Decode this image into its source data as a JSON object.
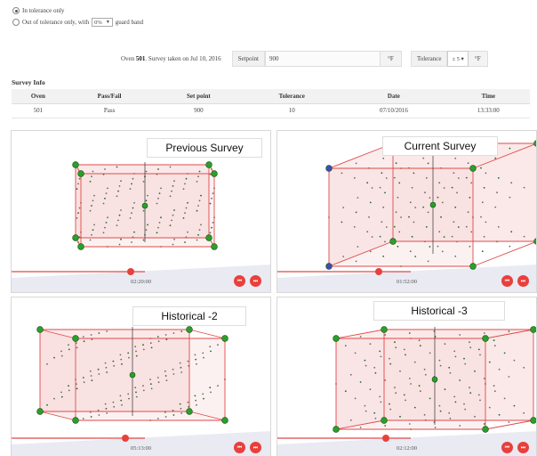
{
  "filter": {
    "option_in_tolerance": "In tolerance only",
    "option_out_prefix": "Out of tolerance only, with",
    "guard_band_value": "0%",
    "option_out_suffix": "guard band"
  },
  "survey_header": {
    "oven_prefix": "Oven",
    "oven_number": "501",
    "taken_on": ". Survey taken on Jul 10, 2016",
    "setpoint_label": "Setpoint",
    "setpoint_value": "900",
    "setpoint_unit": "°F",
    "tolerance_label": "Tolerance",
    "tolerance_value": "± 5",
    "tolerance_unit": "°F"
  },
  "survey_info": {
    "title": "Survey Info",
    "columns": [
      "Oven",
      "Pass/Fail",
      "Set point",
      "Tolerance",
      "Date",
      "Time"
    ],
    "row": [
      "501",
      "Pass",
      "900",
      "10",
      "07/10/2016",
      "13:33:00"
    ]
  },
  "panels": [
    {
      "label": "Previous Survey",
      "time": "02:20:00"
    },
    {
      "label": "Current Survey",
      "time": "01:52:00"
    },
    {
      "label": "Historical -2",
      "time": "05:13:00"
    },
    {
      "label": "Historical -3",
      "time": "02:12:00"
    }
  ],
  "buttons": {
    "prev_glyph": "⏮",
    "next_glyph": "⏭"
  },
  "colors": {
    "cube_edge": "#e0494a",
    "cube_fill": "#f7d7d7",
    "node_green": "#2aa02a",
    "node_dark": "#1f6b1f",
    "node_blue": "#3a4fb5",
    "button_red": "#e8403c"
  }
}
